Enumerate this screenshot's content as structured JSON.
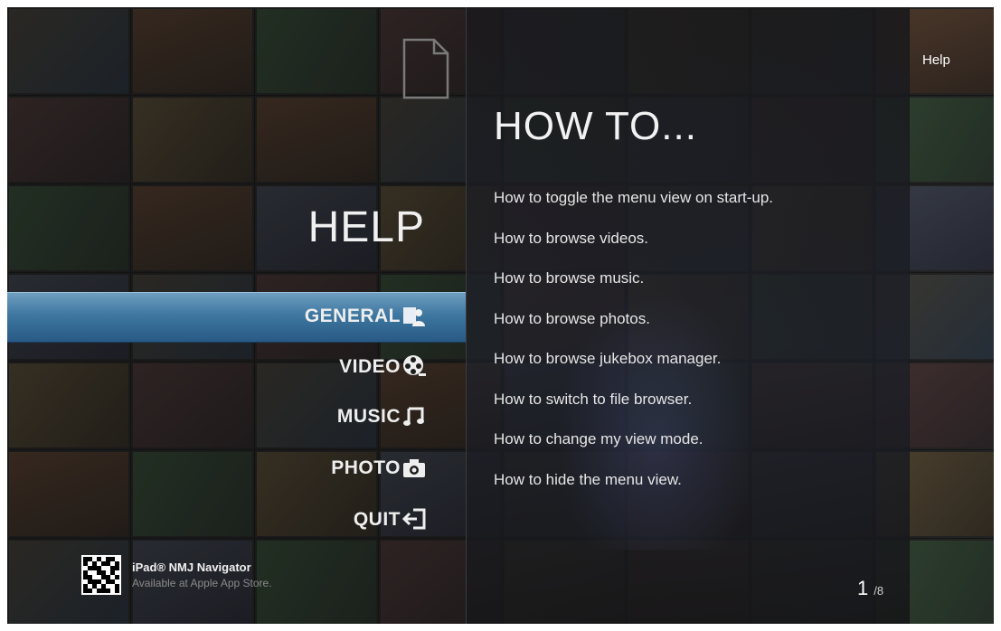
{
  "screen": {
    "help_tab_label": "Help"
  },
  "left_menu": {
    "title": "HELP",
    "items": [
      {
        "label": "GENERAL",
        "icon": "general-help-icon",
        "selected": true
      },
      {
        "label": "VIDEO",
        "icon": "film-reel-icon",
        "selected": false
      },
      {
        "label": "MUSIC",
        "icon": "music-note-icon",
        "selected": false
      },
      {
        "label": "PHOTO",
        "icon": "camera-icon",
        "selected": false
      },
      {
        "label": "QUIT",
        "icon": "exit-icon",
        "selected": false
      }
    ]
  },
  "content": {
    "title": "HOW TO...",
    "topics": [
      "How to toggle the menu view on start-up.",
      "How to browse videos.",
      "How to browse music.",
      "How to browse photos.",
      "How to browse jukebox manager.",
      "How to switch to file browser.",
      "How to change my view mode.",
      "How to hide the menu view."
    ]
  },
  "promo": {
    "title": "iPad® NMJ Navigator",
    "subtitle": "Available at Apple App Store."
  },
  "pager": {
    "current": "1",
    "total": "/8"
  },
  "colors": {
    "selected_bar": "#3e77a0",
    "text": "#eeeeee",
    "panel_bg": "#18181a"
  }
}
